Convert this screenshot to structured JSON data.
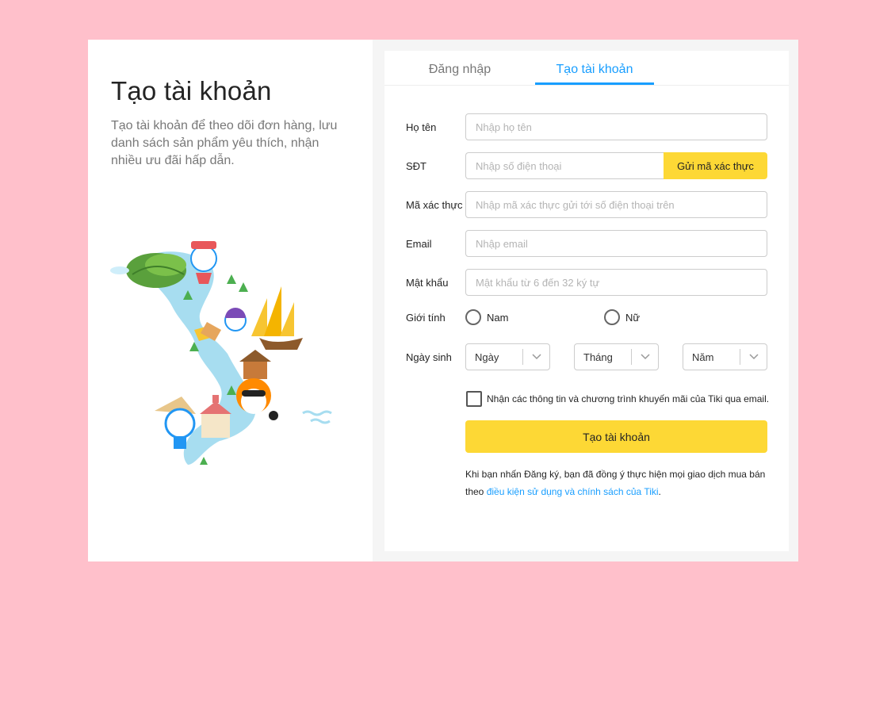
{
  "left": {
    "title": "Tạo tài khoản",
    "description": "Tạo tài khoản để theo dõi đơn hàng, lưu danh sách sản phẩm yêu thích, nhận nhiều ưu đãi hấp dẫn."
  },
  "tabs": [
    {
      "label": "Đăng nhập",
      "active": false
    },
    {
      "label": "Tạo tài khoản",
      "active": true
    }
  ],
  "form": {
    "name": {
      "label": "Họ tên",
      "placeholder": "Nhập họ tên",
      "value": ""
    },
    "phone": {
      "label": "SĐT",
      "placeholder": "Nhập số điện thoại",
      "value": "",
      "send_code_label": "Gửi mã xác thực"
    },
    "code": {
      "label": "Mã xác thực",
      "placeholder": "Nhập mã xác thực gửi tới số điện thoại trên",
      "value": ""
    },
    "email": {
      "label": "Email",
      "placeholder": "Nhập email",
      "value": ""
    },
    "password": {
      "label": "Mật khẩu",
      "placeholder": "Mật khẩu từ 6 đến 32 ký tự",
      "value": ""
    },
    "gender": {
      "label": "Giới tính",
      "options": [
        "Nam",
        "Nữ"
      ],
      "selected": null
    },
    "birthday": {
      "label": "Ngày sinh",
      "day": "Ngày",
      "month": "Tháng",
      "year": "Năm"
    },
    "newsletter": {
      "label": "Nhận các thông tin và chương trình khuyến mãi của Tiki qua email.",
      "checked": false
    },
    "submit_label": "Tạo tài khoản",
    "terms_prefix": "Khi bạn nhấn Đăng ký, bạn đã đồng ý thực hiện mọi giao dịch mua bán theo ",
    "terms_link": "điều kiện sử dụng và chính sách của Tiki",
    "terms_suffix": "."
  },
  "colors": {
    "background": "#ffc0cb",
    "accent_blue": "#189eff",
    "accent_yellow": "#fdd835"
  },
  "icons": {
    "illustration": "vietnam-map-illustration",
    "select_arrow": "chevron-down-icon"
  }
}
